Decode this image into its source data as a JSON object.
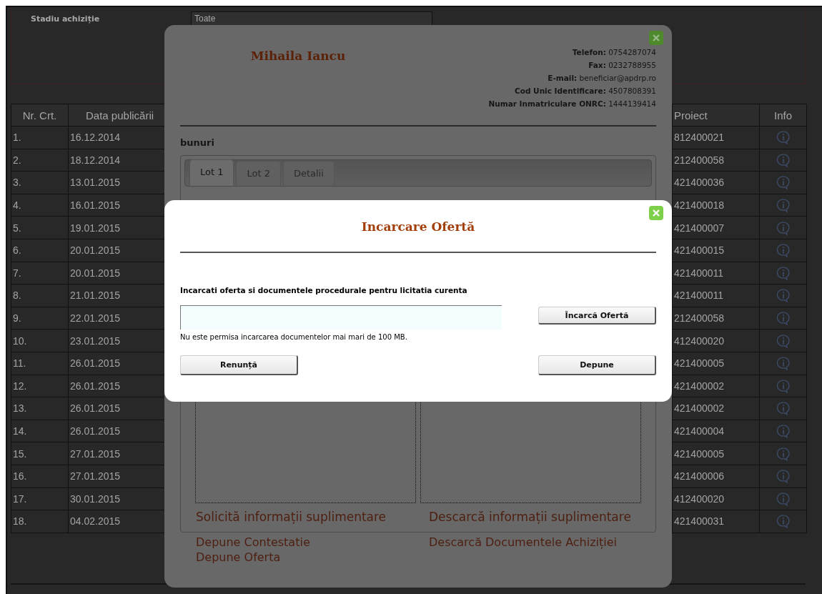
{
  "filter": {
    "label": "Stadiu achiziție",
    "select_value": "Toate"
  },
  "table": {
    "columns": [
      "Nr. Crt.",
      "Data publicării",
      "Proiect",
      "Info"
    ],
    "rows": [
      {
        "nr": "1.",
        "date": "16.12.2014",
        "project": "812400021"
      },
      {
        "nr": "2.",
        "date": "18.12.2014",
        "project": "212400058"
      },
      {
        "nr": "3.",
        "date": "13.01.2015",
        "project": "421400036"
      },
      {
        "nr": "4.",
        "date": "16.01.2015",
        "project": "421400018"
      },
      {
        "nr": "5.",
        "date": "19.01.2015",
        "project": "421400007"
      },
      {
        "nr": "6.",
        "date": "20.01.2015",
        "project": "421400015"
      },
      {
        "nr": "7.",
        "date": "20.01.2015",
        "project": "421400011"
      },
      {
        "nr": "8.",
        "date": "21.01.2015",
        "project": "421400011"
      },
      {
        "nr": "9.",
        "date": "22.01.2015",
        "project": "212400058"
      },
      {
        "nr": "10.",
        "date": "23.01.2015",
        "project": "412400020"
      },
      {
        "nr": "11.",
        "date": "26.01.2015",
        "project": "421400005"
      },
      {
        "nr": "12.",
        "date": "26.01.2015",
        "project": "421400002"
      },
      {
        "nr": "13.",
        "date": "26.01.2015",
        "project": "421400002"
      },
      {
        "nr": "14.",
        "date": "26.01.2015",
        "project": "421400004"
      },
      {
        "nr": "15.",
        "date": "27.01.2015",
        "project": "421400005"
      },
      {
        "nr": "16.",
        "date": "27.01.2015",
        "project": "421400006"
      },
      {
        "nr": "17.",
        "date": "30.01.2015",
        "project": "412400020"
      },
      {
        "nr": "18.",
        "date": "04.02.2015",
        "project": "421400031"
      }
    ]
  },
  "profile_dialog": {
    "name": "Mihaila Iancu",
    "contacts": [
      {
        "label": "Telefon:",
        "value": "0754287074"
      },
      {
        "label": "Fax:",
        "value": "0232788955"
      },
      {
        "label": "E-mail:",
        "value": "beneficiar@apdrp.ro"
      },
      {
        "label": "Cod Unic Identificare:",
        "value": "4507808391"
      },
      {
        "label": "Numar Inmatriculare ONRC:",
        "value": "1444139414"
      }
    ],
    "category": "bunuri",
    "tabs": [
      {
        "label": "Lot 1",
        "selected": true
      },
      {
        "label": "Lot 2",
        "selected": false
      },
      {
        "label": "Detalii",
        "selected": false
      }
    ],
    "panel_links": [
      "Solicită informații suplimentare",
      "Descarcă informații suplimentare"
    ],
    "left_links": [
      "Depune Contestatie",
      "Depune Oferta"
    ],
    "right_links": [
      "Descarcă Documentele Achiziției"
    ]
  },
  "upload_dialog": {
    "title": "Incarcare Ofertă",
    "instruction": "Incarcati oferta si documentele procedurale pentru licitatia curenta",
    "upload_button": "Încarcă Ofertă",
    "note": "Nu este permisa incarcarea documentelor mai mari de 100 MB.",
    "cancel_button": "Renunță",
    "submit_button": "Depune"
  }
}
